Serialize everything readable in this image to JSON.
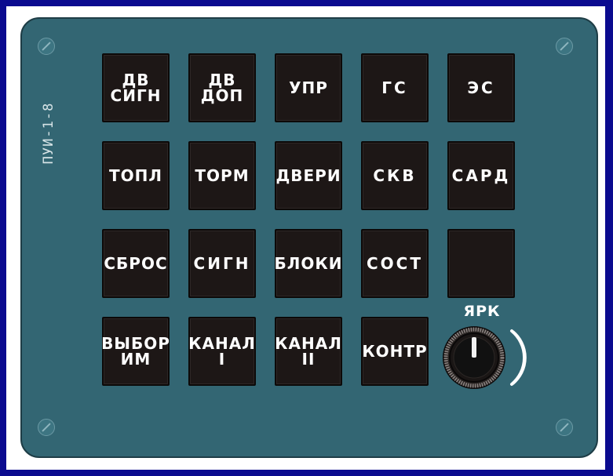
{
  "panel": {
    "label": "ПУИ-1-8"
  },
  "buttons": [
    {
      "id": "dv-sign",
      "label": "ДВ\nСИГН"
    },
    {
      "id": "dv-dop",
      "label": "ДВ\nДОП"
    },
    {
      "id": "upr",
      "label": "УПР"
    },
    {
      "id": "gs",
      "label": "ГС"
    },
    {
      "id": "es",
      "label": "ЭС"
    },
    {
      "id": "topl",
      "label": "ТОПЛ"
    },
    {
      "id": "torm",
      "label": "ТОРМ"
    },
    {
      "id": "dveri",
      "label": "ДВЕРИ"
    },
    {
      "id": "skv",
      "label": "СКВ"
    },
    {
      "id": "sard",
      "label": "САРД"
    },
    {
      "id": "sbros",
      "label": "СБРОС"
    },
    {
      "id": "sign",
      "label": "СИГН"
    },
    {
      "id": "bloki",
      "label": "БЛОКИ"
    },
    {
      "id": "sost",
      "label": "СОСТ"
    },
    {
      "id": "blank",
      "label": ""
    },
    {
      "id": "vybor-im",
      "label": "ВЫБОР\nИМ"
    },
    {
      "id": "kanal-1",
      "label": "КАНАЛ\nI"
    },
    {
      "id": "kanal-2",
      "label": "КАНАЛ\nII"
    },
    {
      "id": "kontr",
      "label": "КОНТР"
    }
  ],
  "brightness": {
    "label": "ЯРК"
  },
  "colors": {
    "frame": "#0b0b8f",
    "panel": "#336673",
    "button": "#1d1716",
    "text": "#ffffff"
  }
}
